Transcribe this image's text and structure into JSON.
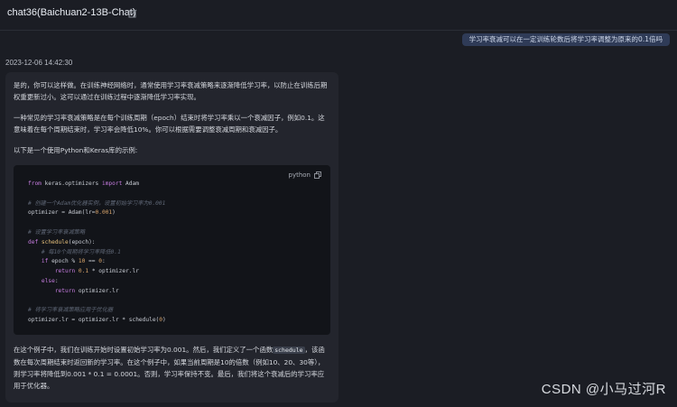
{
  "header": {
    "title": "chat36(Baichuan2-13B-Chat)"
  },
  "user_message": "学习率衰减可以在一定训练轮数后将学习率调整为原来的0.1倍吗",
  "assistant": {
    "timestamp": "2023-12-06 14:42:30",
    "p1": "是的，你可以这样做。在训练神经网络时，通常使用学习率衰减策略来逐渐降低学习率，以防止在训练后期权重更新过小。这可以通过在训练过程中逐渐降低学习率实现。",
    "p2": "一种常见的学习率衰减策略是在每个训练周期（epoch）结束时将学习率乘以一个衰减因子，例如0.1。这意味着在每个周期结束时，学习率会降低10%。你可以根据需要调整衰减周期和衰减因子。",
    "p3": "以下是一个使用Python和Keras库的示例:",
    "code_lang": "python",
    "code": {
      "l1_kw1": "from",
      "l1_mid": " keras.optimizers ",
      "l1_kw2": "import",
      "l1_end": " Adam",
      "l3": "# 创建一个Adam优化器实例，设置初始学习率为0.001",
      "l4_a": "optimizer = Adam(lr=",
      "l4_num": "0.001",
      "l4_b": ")",
      "l6": "# 设置学习率衰减策略",
      "l7_kw": "def",
      "l7_fn": " schedule",
      "l7_end": "(epoch):",
      "l8": "    # 每10个周期将学习率降低0.1",
      "l9_a": "    ",
      "l9_kw": "if",
      "l9_b": " epoch % ",
      "l9_n1": "10",
      "l9_c": " == ",
      "l9_n2": "0",
      "l9_d": ":",
      "l10_a": "        ",
      "l10_kw": "return",
      "l10_sp": " ",
      "l10_num": "0.1",
      "l10_b": " * optimizer.lr",
      "l11_a": "    ",
      "l11_kw": "else",
      "l11_b": ":",
      "l12_a": "        ",
      "l12_kw": "return",
      "l12_b": " optimizer.lr",
      "l14": "# 将学习率衰减策略应用于优化器",
      "l15_a": "optimizer.lr = optimizer.lr * schedule(",
      "l15_num": "0",
      "l15_b": ")"
    },
    "p4_a": "在这个例子中，我们在训练开始时设置初始学习率为0.001。然后，我们定义了一个函数",
    "p4_code": "schedule",
    "p4_b": "，该函数在每次周期结束时返回新的学习率。在这个例子中，如果当前周期是10的倍数（例如10、20、30等），则学习率将降低到0.001 * 0.1 = 0.0001。否则，学习率保持不变。最后，我们将这个衰减后的学习率应用于优化器。"
  },
  "watermark": "CSDN @小马过河R",
  "icons": {
    "edit": "edit-icon",
    "copy": "copy-icon"
  }
}
